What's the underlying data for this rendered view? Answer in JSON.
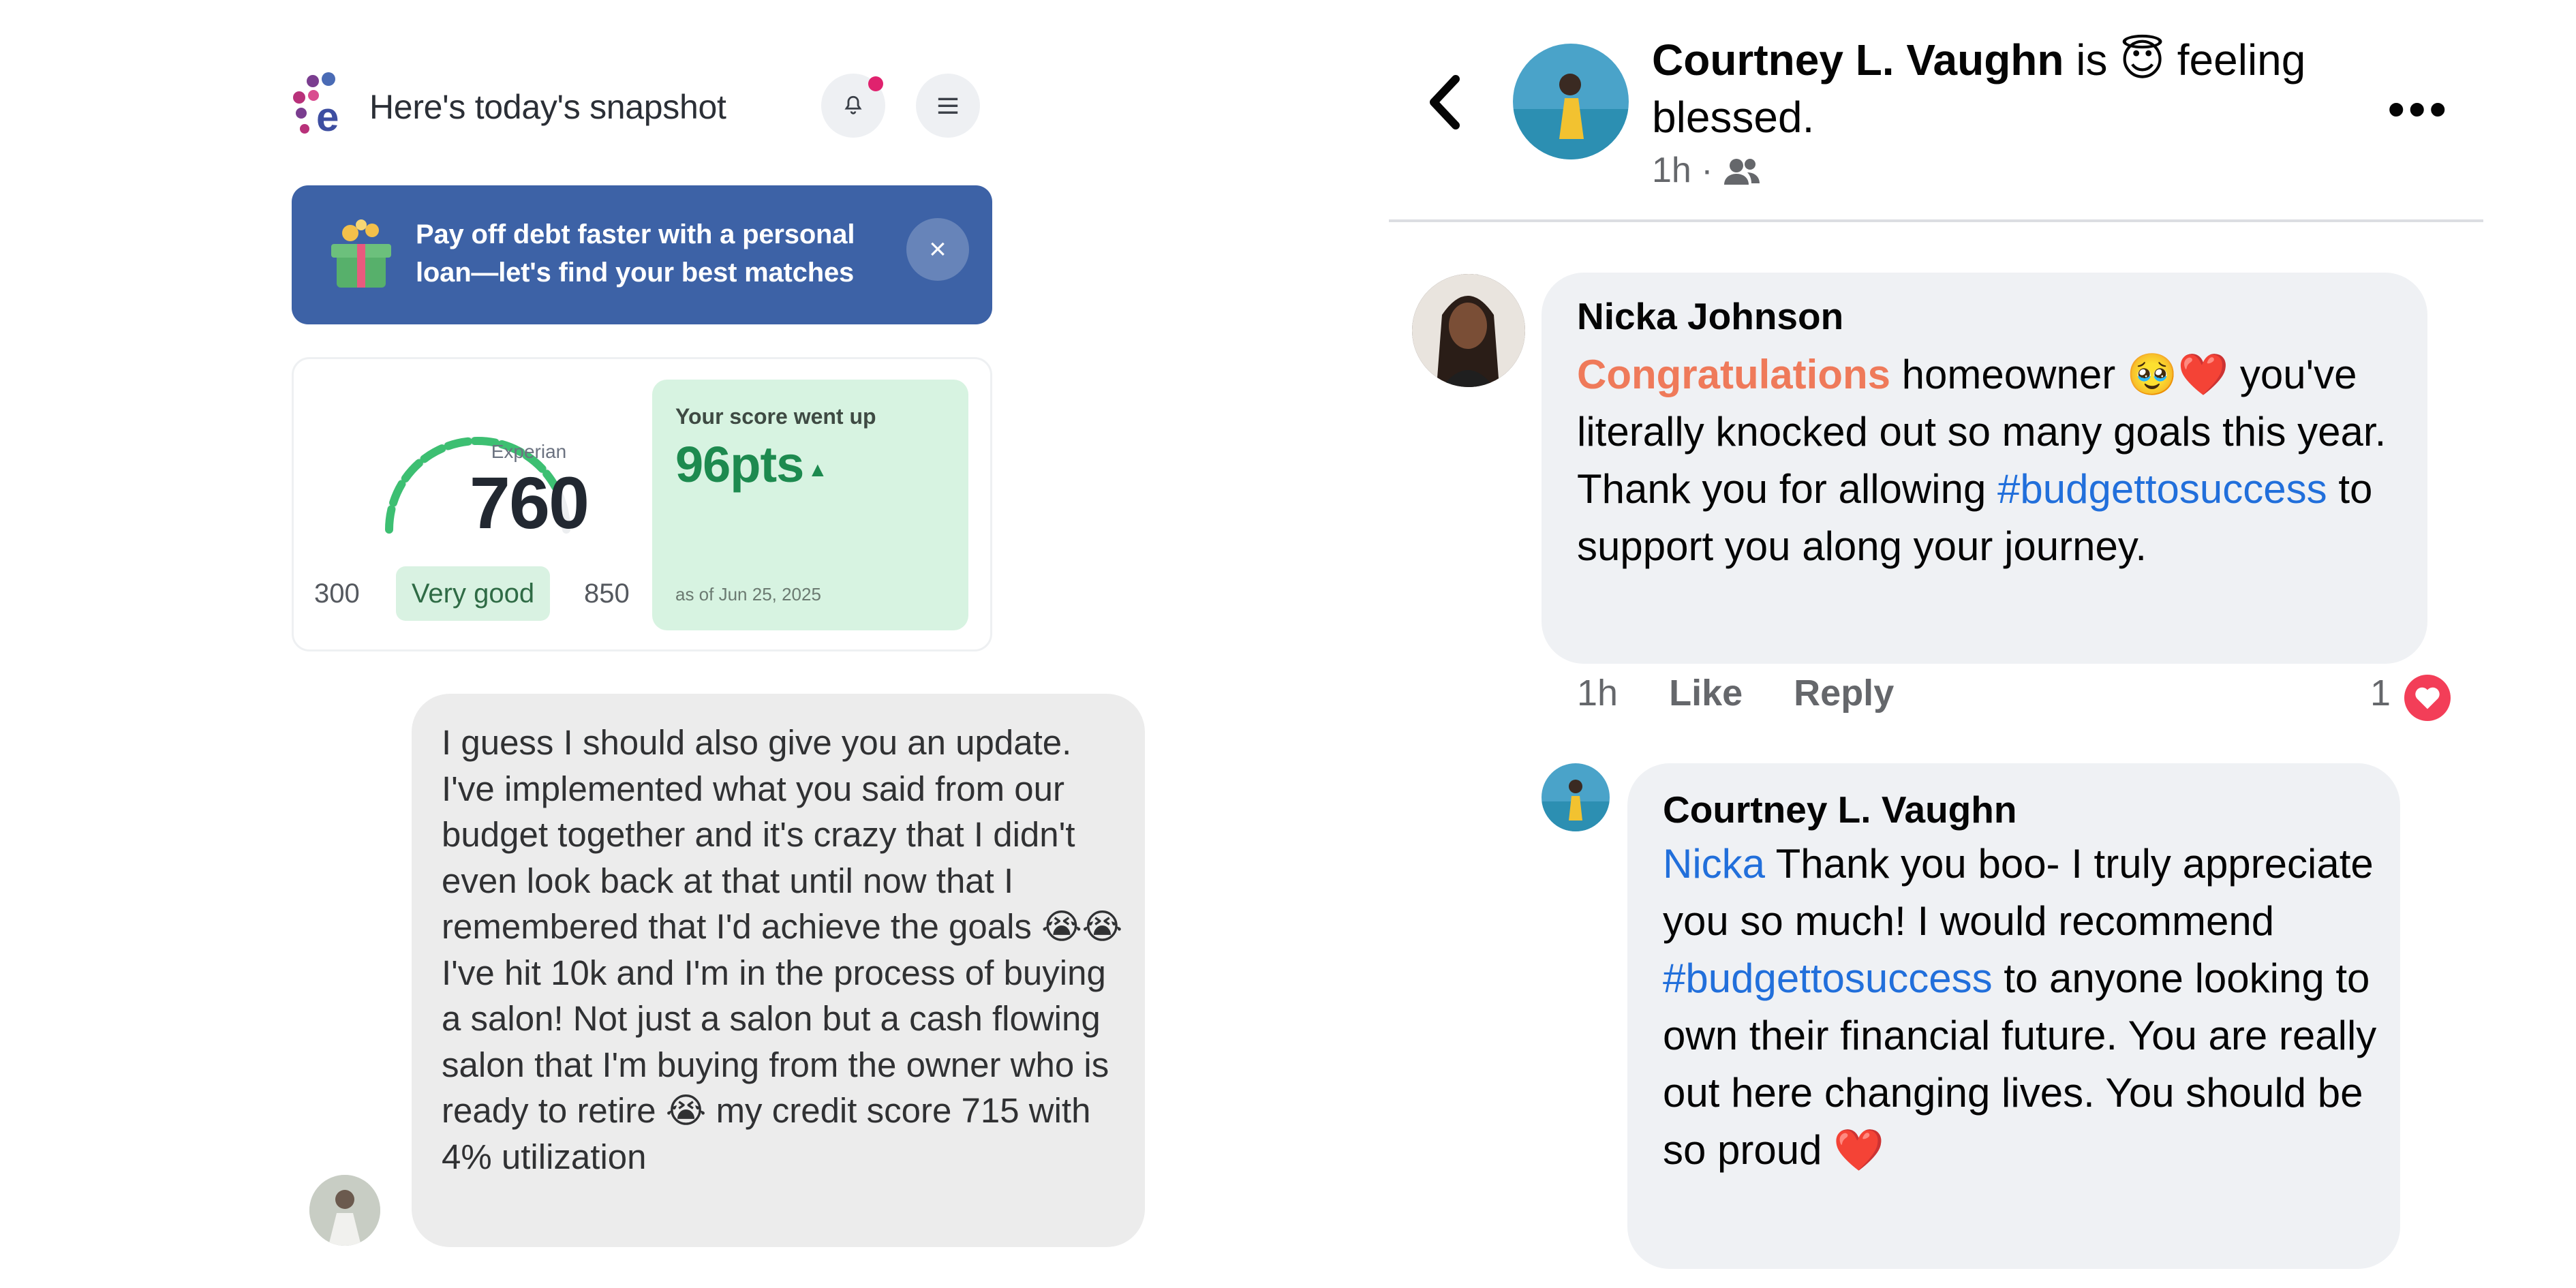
{
  "left_app": {
    "header_title": "Here's today's snapshot",
    "promo": {
      "text": "Pay off debt faster with a personal loan—let's find your best matches",
      "close_glyph": "×"
    },
    "score_card": {
      "bureau": "Experian",
      "score": "760",
      "range_min": "300",
      "range_max": "850",
      "rating": "Very good",
      "gauge_fill": 0.84
    },
    "score_change": {
      "label": "Your score went up",
      "value": "96pts",
      "arrow": "▲",
      "date": "as of Jun 25, 2025"
    },
    "message": {
      "text": "I guess I should also give you an update. I've implemented what you said from our budget together and it's crazy that I didn't even look back at that until now that I remembered that I'd achieve the goals 😭😭 I've hit 10k and I'm in the process of buying a salon! Not just a salon but a cash flowing salon that I'm buying from the owner who is ready to retire 😭 my credit score 715 with 4% utilization"
    }
  },
  "facebook": {
    "post": {
      "author": "Courtney L. Vaughn",
      "verb": " is ",
      "feeling_emoji": "😇",
      "feeling": " feeling blessed.",
      "time": "1h",
      "separator": "·",
      "audience_icon": "friends-icon",
      "more_glyph": "•••"
    },
    "comment1": {
      "author": "Nicka Johnson",
      "highlight": "Congratulations",
      "text_a": " homeowner 🥹❤️ you've literally knocked out so many goals this year. Thank you for allowing ",
      "hashtag": "#budgettosuccess",
      "text_b": " to support you along your journey.",
      "time": "1h",
      "like": "Like",
      "reply": "Reply",
      "reaction_count": "1"
    },
    "comment2": {
      "author": "Courtney L. Vaughn",
      "mention": "Nicka",
      "text_a": " Thank you boo- I truly appreciate you so much! I would recommend ",
      "hashtag": "#budgettosuccess",
      "text_b": " to anyone looking to own their financial future. You are really out here changing lives. You should be so proud ❤️"
    }
  },
  "colors": {
    "promo_bg": "#3d62a6",
    "score_green": "#1d8a4f",
    "fb_blue": "#216fdb",
    "congrats_orange": "#ef7a5a",
    "heart_red": "#f33e58"
  }
}
